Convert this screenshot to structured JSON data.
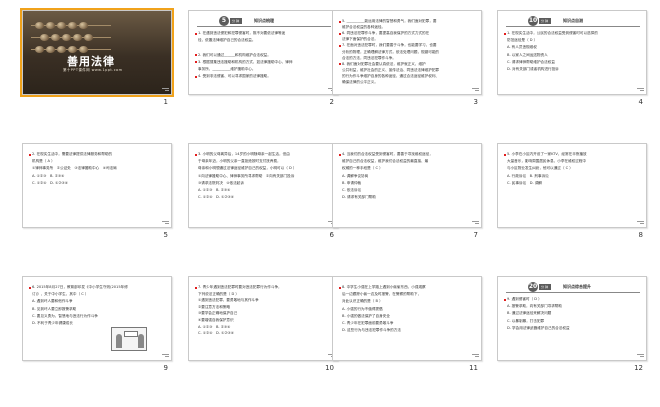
{
  "slides": [
    {
      "num": "1",
      "title": "善用法律",
      "subtitle": "第十PPT课件网 www.1ppt.com"
    },
    {
      "num": "2",
      "circle": "5",
      "badge": "分钟",
      "header": "知识点梳理",
      "lines": [
        "1. 在遇到违法侵犯和犯罪侵害时，既不对要依法律等途",
        "径，依靠法律维护自己的合法权益。",
        "",
        "2. 我们可以通过______和机构维护合法权益。",
        "3. 根据搜集违法援助和机构的方式、如法律援助中心、律师",
        "事务所、__________维护援助中心。",
        "4. 受到非法侵害、可以寻求国家的法律援助。"
      ]
    },
    {
      "num": "3",
      "lines": [
        "5. __________能运用法律的智慧和勇气，我们面对犯罪，要",
        "维护合法权益的各种途径。",
        "6. 同违法犯罪作斗争，要提高自我保护的方式力式的在",
        "法律下面保护的合法。",
        "7. 在面对违法犯罪时，我们要善于斗争，也能要学习，也要",
        "分析的物理，正确理解法律方式，依法处理问题，规避可能的",
        "合法的方法，同违法犯罪作斗争。",
        "8. 我们面对犯罪社会要认真依法，维护就正义、维护",
        "公共利益，维护社会的正义、宣传法治、同违法法律维护犯罪",
        "的行为作斗争维护自身的各种途径，通过合法途径维护权利、",
        "确保法律的公平正义。"
      ]
    },
    {
      "num": "4",
      "circle": "10",
      "badge": "分钟",
      "header": "知识点自测",
      "lines": [
        "1. 在现实生活中，公民的合法权益受到侵害时可以选择的",
        "防范途径是（  D  ）",
        "A. 有人员违规维权",
        "B. 以家人之间运送物资人",
        "C. 请求律师帮助维护合法权益",
        "D. 对有关部门或者机构进行投诉"
      ]
    },
    {
      "num": "5",
      "lines": [
        "2. 在现实生活中，需要法律提供法律服务和帮助的",
        "机构是（  A  ）",
        "①律师事务所　②公证处　③法律援助中心　④司法局",
        "A. ①②③　B. ②③④",
        "C. ①②④　D. ①②③④"
      ]
    },
    {
      "num": "6",
      "lines": [
        "3. 小明的父母离异后，14岁的小明随母亲一起生活，但由",
        "于母亲年迈，小明的父亲一直拒绝按时支付抚养费，",
        "母亲和小明想通过法律途径维护自己的权益，小明可以（  D  ）",
        "①向法律援助中心、律师事务所寻求帮助　②向有关部门投诉",
        "③请求法院判决　④依法起诉",
        "A. ①②③　B. ②③④",
        "C. ①②④　D. ①②③④"
      ]
    },
    {
      "num": "7",
      "lines": [
        "4. 当我们的合法权益受到侵害时，要善于寻找维权途径，",
        "维护自己的合法权益，维护我们合法权益的最直接、最",
        "权威的一种手段是（  C  ）",
        "A. 调解争议协商",
        "B. 申请仲裁",
        "C. 依法诉讼",
        "D. 请求有关部门帮助"
      ]
    },
    {
      "num": "8",
      "lines": [
        "5. 小李在小区内开设了一家KTV，经常在半夜播放",
        "大量音乐，影响周围居民休息，小李在维权过程中",
        "与小区物业发生纠纷，他可以通过（  C  ）",
        "A. 行政诉讼　B. 刑事诉讼",
        "C. 民事诉讼　D. 调解"
      ]
    },
    {
      "num": "9",
      "lines": [
        "6. 2015年8月27日，教育部印发《中小学生守则(2015年修",
        "订)》，关于中小学生，其中（  C  ）",
        "A. 遇到坏人要和他作斗争",
        "B. 见到坏人要立即报警求助",
        "C. 要见义勇为，智慧地与违法行为作斗争",
        "D. 不利于青少年健康成长"
      ]
    },
    {
      "num": "10",
      "lines": [
        "7. 青少年遇到违法犯罪时要对违法犯罪行为作斗争，",
        "下列说法正确的是（  D  ）",
        "①遇到违法犯罪，要勇敢地与其作斗争",
        "②要注意方法和策略",
        "③要学会正确地保护自己",
        "④要增强自我保护意识",
        "A. ①②③　B. ②③④",
        "C. ①②④　D. ①②③④"
      ]
    },
    {
      "num": "11",
      "lines": [
        "8. 中学生小强在上学路上遇到小偷偷东西，小强观察",
        "后一边跟踪小偷一边及时报警，在警察的帮助下，",
        "对此认识正确的是（  B  ）",
        "A. 小强的行为不值得提倡",
        "B. 小强的做法保护了自身安全",
        "C. 青少年在犯罪面前要勇敢斗争",
        "D. 这些行为与违法犯罪作斗争的方法"
      ]
    },
    {
      "num": "12",
      "circle": "20",
      "badge": "分钟",
      "header": "知识点综合提升",
      "lines": [
        "9. 遇到侵害时（  D  ）",
        "A. 报警求助，向有关部门寻求帮助",
        "B. 通过法律途径来解决问题",
        "C. 以暴制暴，打击犯罪",
        "D. 学会用法律武器维护自己的合法权益"
      ]
    }
  ]
}
